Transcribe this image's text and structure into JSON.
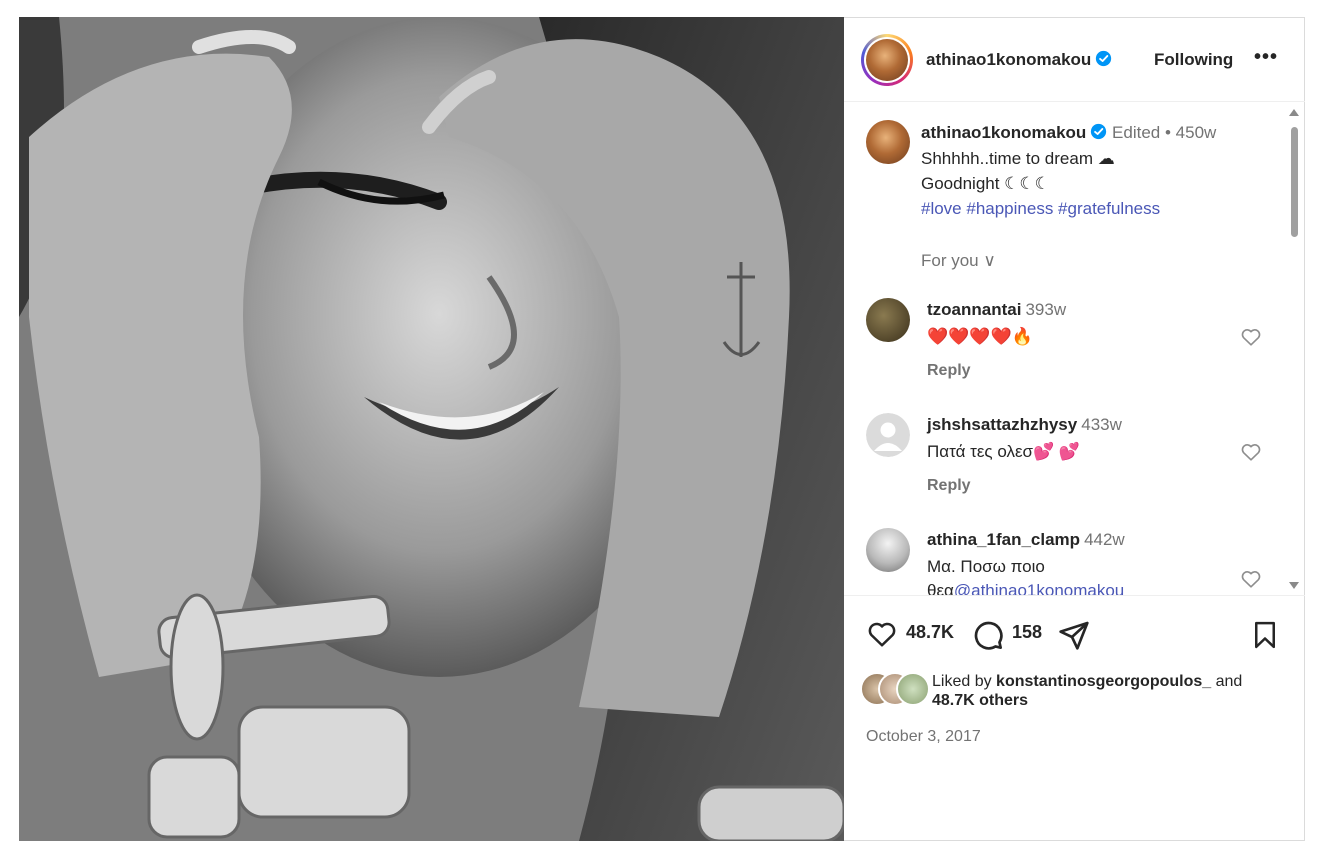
{
  "post": {
    "author": "athinao1konomakou",
    "follow_label": "Following",
    "more_label": "•••"
  },
  "caption": {
    "username": "athinao1konomakou",
    "edited": "Edited",
    "separator": "•",
    "age": "450w",
    "line1": "Shhhhh..time to dream ☁",
    "line2": "Goodnight ☾☾☾",
    "hashtags": "#love #happiness #gratefulness"
  },
  "foryou_label": "For you ∨",
  "comments": [
    {
      "username": "tzoannantai",
      "age": "393w",
      "text": "❤️❤️❤️❤️🔥",
      "reply": "Reply"
    },
    {
      "username": "jshshsattazhzhysy",
      "age": "433w",
      "text": "Πατά τες ολεσ💕 💕",
      "reply": "Reply"
    },
    {
      "username": "athina_1fan_clamp",
      "age": "442w",
      "text": "Μα. Ποσω ποιο",
      "text2_prefix": "θεα",
      "mention": "@athinao1konomakou"
    }
  ],
  "stats": {
    "likes": "48.7K",
    "comments": "158"
  },
  "liked_by": {
    "prefix": "Liked by ",
    "user": "konstantinosgeorgopoulos_",
    "and": " and ",
    "others": "48.7K others"
  },
  "date": "October 3, 2017",
  "colors": {
    "link": "#4a57b6",
    "verified": "#0095f6",
    "muted": "#737373"
  },
  "icons": [
    "verified-badge-icon",
    "heart-icon",
    "comment-icon",
    "share-icon",
    "bookmark-icon",
    "chevron-down-icon",
    "default-avatar-icon"
  ]
}
